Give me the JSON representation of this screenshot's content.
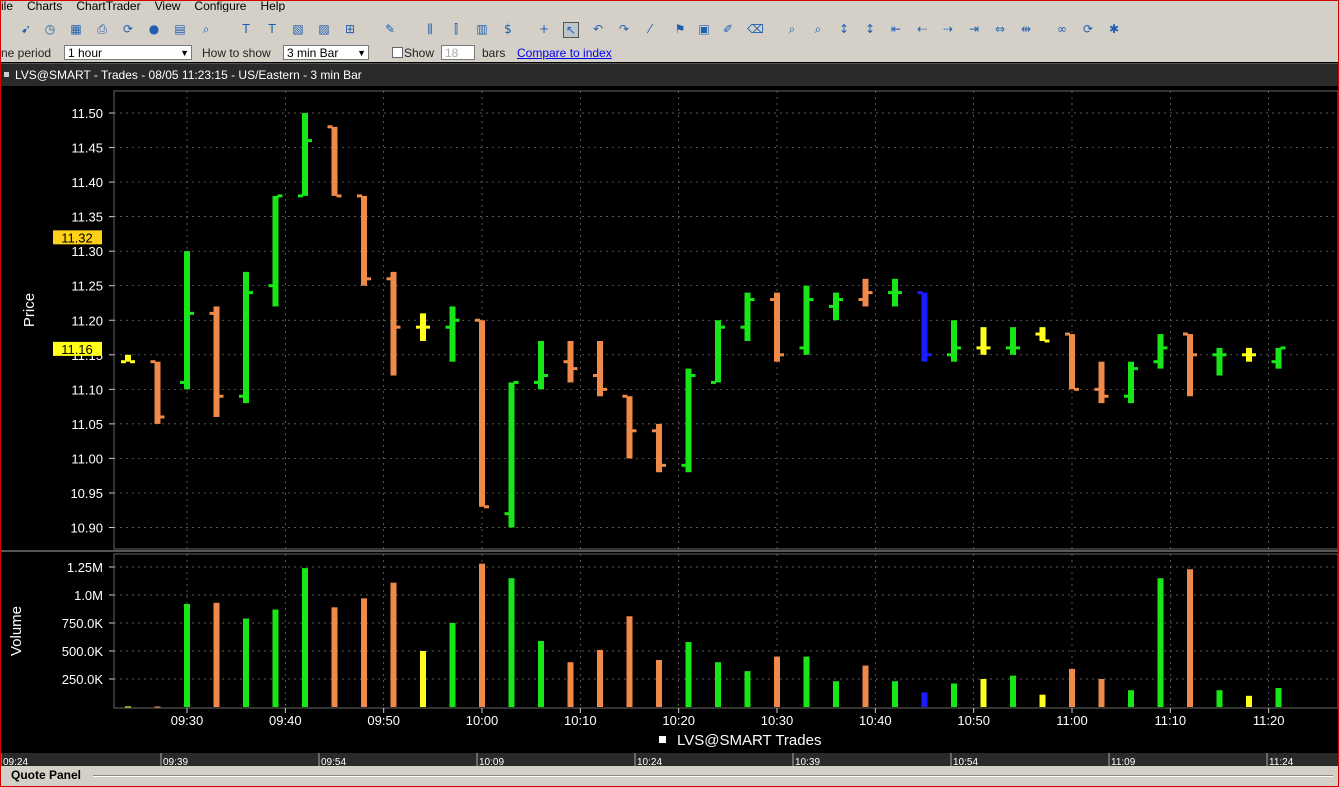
{
  "menu": [
    "ile",
    "Charts",
    "ChartTrader",
    "View",
    "Configure",
    "Help"
  ],
  "options": {
    "time_period_label": "ne period",
    "time_period_value": "1 hour",
    "how_to_show_label": "How to show",
    "how_to_show_value": "3 min Bar",
    "show_label": "Show",
    "show_count": "18",
    "bars_label": "bars",
    "compare_link": "Compare to index"
  },
  "chart_title": "LVS@SMART - Trades - 08/05 11:23:15  - US/Eastern - 3 min Bar",
  "legend": "LVS@SMART Trades",
  "quote_panel": "Quote Panel",
  "colors": {
    "up": "#19e619",
    "down": "#f08a4b",
    "flat": "#ffff1a",
    "blue": "#1b1bff",
    "last_tag": "#ffd21a",
    "bid_tag": "#ffff1a"
  },
  "price_panel": {
    "ylabel": "Price",
    "ticks": [
      "11.50",
      "11.45",
      "11.40",
      "11.35",
      "11.30",
      "11.25",
      "11.20",
      "11.15",
      "11.10",
      "11.05",
      "11.00",
      "10.95",
      "10.90"
    ],
    "tag_last": "11.32",
    "tag_current": "11.16"
  },
  "volume_panel": {
    "ylabel": "Volume",
    "ticks": [
      "1.25M",
      "1.0M",
      "750.0K",
      "500.0K",
      "250.0K"
    ]
  },
  "time_ticks": [
    "09:30",
    "09:40",
    "09:50",
    "10:00",
    "10:10",
    "10:20",
    "10:30",
    "10:40",
    "10:50",
    "11:00",
    "11:10",
    "11:20"
  ],
  "overview_ticks": [
    "09:24",
    "09:39",
    "09:54",
    "10:09",
    "10:24",
    "10:39",
    "10:54",
    "11:09",
    "11:24"
  ],
  "chart_data": {
    "type": "ohlc",
    "x": [
      "09:24",
      "09:27",
      "09:30",
      "09:33",
      "09:36",
      "09:39",
      "09:42",
      "09:45",
      "09:48",
      "09:51",
      "09:54",
      "09:57",
      "10:00",
      "10:03",
      "10:06",
      "10:09",
      "10:12",
      "10:15",
      "10:18",
      "10:21",
      "10:24",
      "10:27",
      "10:30",
      "10:33",
      "10:36",
      "10:39",
      "10:42",
      "10:45",
      "10:48",
      "10:51",
      "10:54",
      "10:57",
      "11:00",
      "11:03",
      "11:06",
      "11:09",
      "11:12",
      "11:15",
      "11:18",
      "11:21"
    ],
    "open": [
      11.14,
      11.14,
      11.11,
      11.21,
      11.09,
      11.25,
      11.38,
      11.48,
      11.38,
      11.26,
      11.19,
      11.19,
      11.2,
      10.92,
      11.11,
      11.14,
      11.12,
      11.09,
      11.04,
      10.99,
      11.11,
      11.19,
      11.23,
      11.16,
      11.22,
      11.23,
      11.24,
      11.24,
      11.15,
      11.16,
      11.16,
      11.18,
      11.18,
      11.1,
      11.09,
      11.14,
      11.18,
      11.15,
      11.15,
      11.14
    ],
    "high": [
      11.15,
      11.14,
      11.3,
      11.22,
      11.27,
      11.38,
      11.5,
      11.48,
      11.38,
      11.27,
      11.21,
      11.22,
      11.2,
      11.11,
      11.17,
      11.17,
      11.17,
      11.09,
      11.05,
      11.13,
      11.2,
      11.24,
      11.24,
      11.25,
      11.24,
      11.26,
      11.26,
      11.24,
      11.2,
      11.19,
      11.19,
      11.19,
      11.18,
      11.14,
      11.14,
      11.18,
      11.18,
      11.16,
      11.16,
      11.16
    ],
    "low": [
      11.14,
      11.05,
      11.1,
      11.06,
      11.08,
      11.22,
      11.38,
      11.38,
      11.25,
      11.12,
      11.17,
      11.14,
      10.93,
      10.9,
      11.1,
      11.11,
      11.09,
      11.0,
      10.98,
      10.98,
      11.11,
      11.17,
      11.14,
      11.15,
      11.2,
      11.22,
      11.22,
      11.14,
      11.14,
      11.15,
      11.15,
      11.17,
      11.1,
      11.08,
      11.08,
      11.13,
      11.09,
      11.12,
      11.14,
      11.13
    ],
    "close": [
      11.14,
      11.06,
      11.21,
      11.09,
      11.24,
      11.38,
      11.46,
      11.38,
      11.26,
      11.19,
      11.19,
      11.2,
      10.93,
      11.11,
      11.12,
      11.13,
      11.1,
      11.04,
      10.99,
      11.12,
      11.19,
      11.23,
      11.15,
      11.23,
      11.23,
      11.24,
      11.24,
      11.15,
      11.16,
      11.16,
      11.16,
      11.17,
      11.1,
      11.09,
      11.13,
      11.16,
      11.15,
      11.15,
      11.15,
      11.16
    ],
    "volume": [
      5000,
      5000,
      920000,
      930000,
      790000,
      870000,
      1240000,
      890000,
      970000,
      1110000,
      500000,
      750000,
      1280000,
      1150000,
      590000,
      400000,
      510000,
      810000,
      420000,
      580000,
      400000,
      320000,
      450000,
      450000,
      230000,
      370000,
      230000,
      130000,
      210000,
      250000,
      280000,
      110000,
      340000,
      250000,
      150000,
      1150000,
      1230000,
      150000,
      100000,
      170000
    ],
    "color": [
      "flat",
      "down",
      "up",
      "down",
      "up",
      "up",
      "up",
      "down",
      "down",
      "down",
      "flat",
      "up",
      "down",
      "up",
      "up",
      "down",
      "down",
      "down",
      "down",
      "up",
      "up",
      "up",
      "down",
      "up",
      "up",
      "down",
      "up",
      "blue",
      "up",
      "flat",
      "up",
      "flat",
      "down",
      "down",
      "up",
      "up",
      "down",
      "up",
      "flat",
      "up"
    ],
    "ylim_price": [
      10.88,
      11.53
    ],
    "ylim_volume": [
      0,
      1350000
    ]
  }
}
